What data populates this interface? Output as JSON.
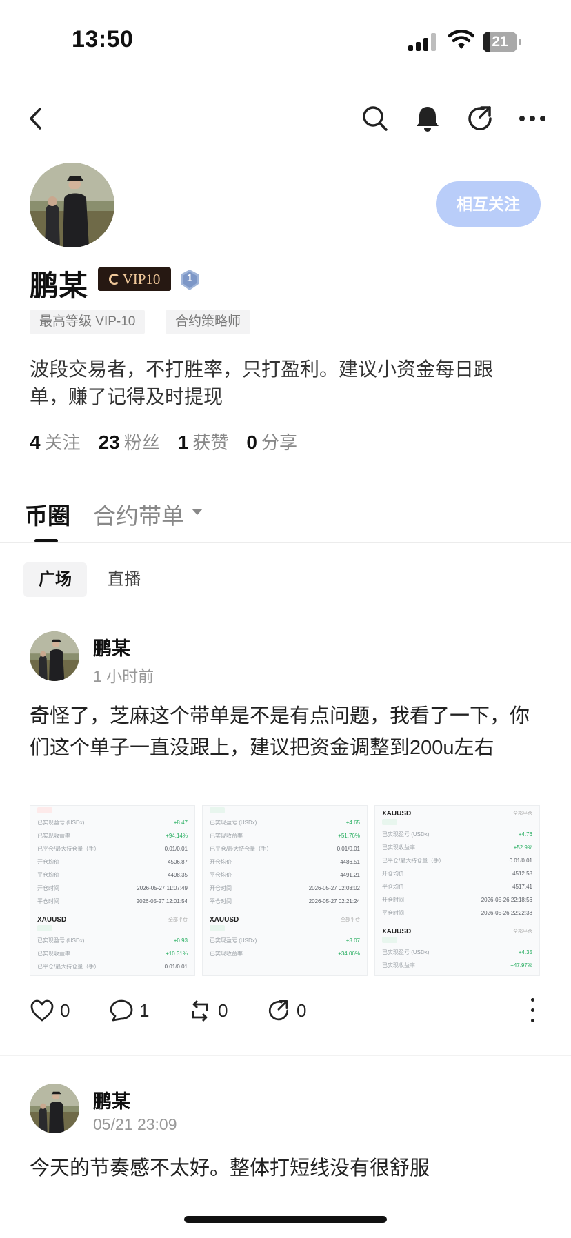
{
  "status": {
    "time": "13:50",
    "battery": "21",
    "battery_level": 0.21
  },
  "profile": {
    "name": "鹏某",
    "vip_label": "VIP10",
    "level_badge": "1",
    "follow_button": "相互关注",
    "tags": [
      "最高等级 VIP-10",
      "合约策略师"
    ],
    "bio": "波段交易者，不打胜率，只打盈利。建议小资金每日跟单，赚了记得及时提现",
    "stats": [
      {
        "num": "4",
        "label": "关注"
      },
      {
        "num": "23",
        "label": "粉丝"
      },
      {
        "num": "1",
        "label": "获赞"
      },
      {
        "num": "0",
        "label": "分享"
      }
    ]
  },
  "tabs": {
    "active": "币圈",
    "secondary": "合约带单"
  },
  "subtabs": {
    "active": "广场",
    "other": "直播"
  },
  "posts": [
    {
      "author": "鹏某",
      "time": "1 小时前",
      "body": "奇怪了，芝麻这个带单是不是有点问题，我看了一下，你们这个单子一直没跟上，建议把资金调整到200u左右",
      "actions": {
        "likes": "0",
        "comments": "1",
        "reposts": "0",
        "shares": "0"
      },
      "thumbnails": [
        {
          "top_badge": "red",
          "rows": [
            {
              "k": "已实现盈亏 (USDx)",
              "v": "+8.47",
              "g": true
            },
            {
              "k": "已实现收益率",
              "v": "+94.14%",
              "g": true
            },
            {
              "k": "已平仓/最大持仓量（手）",
              "v": "0.01/0.01"
            },
            {
              "k": "开仓均价",
              "v": "4506.87"
            },
            {
              "k": "平仓均价",
              "v": "4498.35"
            },
            {
              "k": "开仓时间",
              "v": "2026-05-27 11:07:49"
            },
            {
              "k": "平仓时间",
              "v": "2026-05-27 12:01:54"
            }
          ],
          "second_header": "XAUUSD",
          "second_tag": "全部平仓",
          "second_rows": [
            {
              "k": "已实现盈亏 (USDx)",
              "v": "+0.93",
              "g": true
            },
            {
              "k": "已实现收益率",
              "v": "+10.31%",
              "g": true
            },
            {
              "k": "已平仓/最大持仓量（手）",
              "v": "0.01/0.01"
            }
          ]
        },
        {
          "top_badge": "green",
          "rows": [
            {
              "k": "已实现盈亏 (USDx)",
              "v": "+4.65",
              "g": true
            },
            {
              "k": "已实现收益率",
              "v": "+51.76%",
              "g": true
            },
            {
              "k": "已平仓/最大持仓量（手）",
              "v": "0.01/0.01"
            },
            {
              "k": "开仓均价",
              "v": "4486.51"
            },
            {
              "k": "平仓均价",
              "v": "4491.21"
            },
            {
              "k": "开仓时间",
              "v": "2026-05-27 02:03:02"
            },
            {
              "k": "平仓时间",
              "v": "2026-05-27 02:21:24"
            }
          ],
          "second_header": "XAUUSD",
          "second_tag": "全部平仓",
          "second_rows": [
            {
              "k": "已实现盈亏 (USDx)",
              "v": "+3.07",
              "g": true
            },
            {
              "k": "已实现收益率",
              "v": "+34.06%",
              "g": true
            }
          ]
        },
        {
          "header": "XAUUSD",
          "header_tag": "全部平仓",
          "top_badge": "green",
          "rows": [
            {
              "k": "已实现盈亏 (USDx)",
              "v": "+4.76",
              "g": true
            },
            {
              "k": "已实现收益率",
              "v": "+52.9%",
              "g": true
            },
            {
              "k": "已平仓/最大持仓量（手）",
              "v": "0.01/0.01"
            },
            {
              "k": "开仓均价",
              "v": "4512.58"
            },
            {
              "k": "平仓均价",
              "v": "4517.41"
            },
            {
              "k": "开仓时间",
              "v": "2026-05-26 22:18:56"
            },
            {
              "k": "平仓时间",
              "v": "2026-05-26 22:22:38"
            }
          ],
          "second_header": "XAUUSD",
          "second_tag": "全部平仓",
          "second_rows": [
            {
              "k": "已实现盈亏 (USDx)",
              "v": "+4.35",
              "g": true
            },
            {
              "k": "已实现收益率",
              "v": "+47.97%",
              "g": true
            }
          ]
        }
      ]
    },
    {
      "author": "鹏某",
      "time": "05/21 23:09",
      "body": "今天的节奏感不太好。整体打短线没有很舒服"
    }
  ],
  "colors": {
    "follow_bg": "#b9cdf9",
    "vip_bg": "#261812",
    "vip_gold": "#f0c89a",
    "gain_green": "#27ae60"
  },
  "icons": [
    "back-icon",
    "search-icon",
    "bell-icon",
    "share-icon",
    "more-icon",
    "heart-icon",
    "comment-icon",
    "repost-icon",
    "forward-icon",
    "kebab-icon"
  ]
}
